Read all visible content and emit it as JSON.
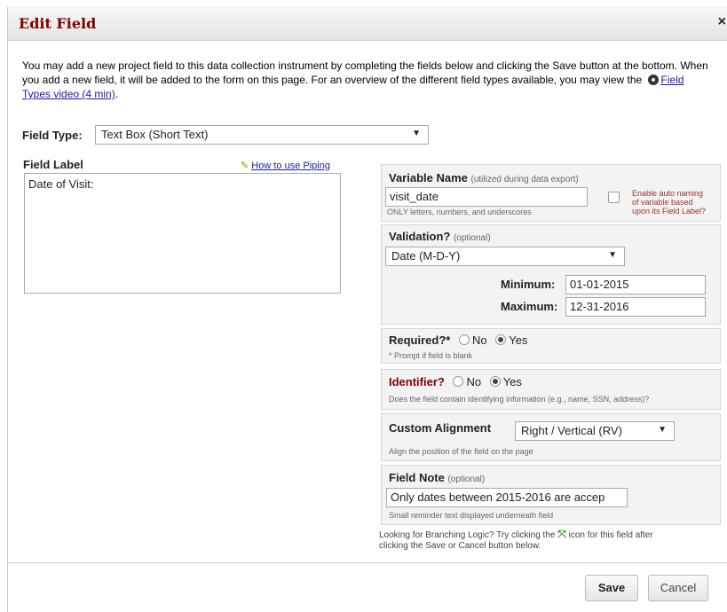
{
  "dialog": {
    "title": "Edit Field",
    "close_glyph": "×"
  },
  "intro": {
    "text_before": "You may add a new project field to this data collection instrument by completing the fields below and clicking the Save button at the bottom. When you add a new field, it will be added to the form on this page. For an overview of the different field types available, you may view the",
    "video_link": "Field Types video (4 min)",
    "text_after": "."
  },
  "field_type": {
    "label": "Field Type:",
    "value": "Text Box (Short Text)"
  },
  "field_label": {
    "heading": "Field Label",
    "piping_link": "How to use Piping",
    "value": "Date of Visit:"
  },
  "variable": {
    "heading": "Variable Name",
    "heading_note": "(utilized during data export)",
    "value": "visit_date",
    "hint": "ONLY letters, numbers, and underscores",
    "auto_naming_line1": "Enable auto naming",
    "auto_naming_line2": "of variable based",
    "auto_naming_line3": "upon its Field Label?"
  },
  "validation": {
    "heading": "Validation?",
    "heading_note": "(optional)",
    "value": "Date (M-D-Y)",
    "min_label": "Minimum:",
    "min_value": "01-01-2015",
    "max_label": "Maximum:",
    "max_value": "12-31-2016"
  },
  "required": {
    "heading": "Required?*",
    "no": "No",
    "yes": "Yes",
    "hint": "* Prompt if field is blank",
    "selected": "Yes"
  },
  "identifier": {
    "heading": "Identifier?",
    "no": "No",
    "yes": "Yes",
    "hint": "Does the field contain identifying information (e.g., name, SSN, address)?",
    "selected": "Yes"
  },
  "alignment": {
    "heading": "Custom Alignment",
    "value": "Right / Vertical (RV)",
    "hint": "Align the position of the field on the page"
  },
  "field_note": {
    "heading": "Field Note",
    "heading_note": "(optional)",
    "value": "Only dates between 2015-2016 are accep",
    "hint": "Small reminder text displayed underneath field"
  },
  "branching": {
    "text_before": "Looking for Branching Logic? Try clicking the",
    "text_after": "icon for this field after",
    "line2": "clicking the Save or Cancel button below."
  },
  "buttons": {
    "save": "Save",
    "cancel": "Cancel"
  },
  "colors": {
    "title": "#800000",
    "identifier": "#800000",
    "auto_naming": "#a03030",
    "branch_icon": "#2e9e2e"
  }
}
